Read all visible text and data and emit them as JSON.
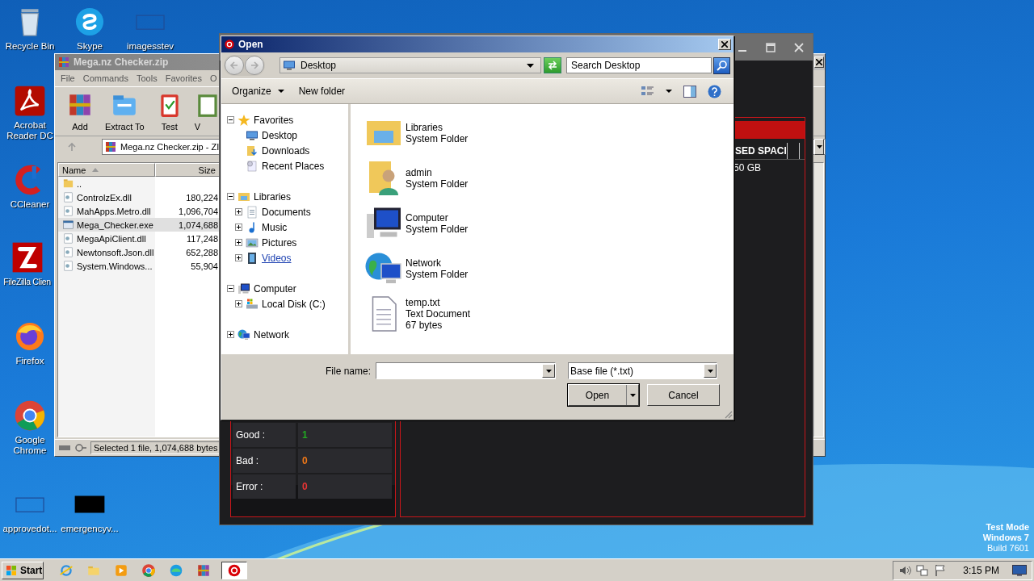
{
  "desktop_icons": [
    {
      "label": "Recycle Bin",
      "kind": "recycle"
    },
    {
      "label": "Skype",
      "kind": "skype"
    },
    {
      "label": "imagesstev",
      "kind": "blankimg"
    },
    {
      "label": "Acrobat Reader DC",
      "kind": "acrobat"
    },
    {
      "label": "CCleaner",
      "kind": "ccleaner"
    },
    {
      "label": "FileZilla Clien",
      "kind": "filezilla"
    },
    {
      "label": "Firefox",
      "kind": "firefox"
    },
    {
      "label": "Google Chrome",
      "kind": "chrome"
    },
    {
      "label": "approvedot...",
      "kind": "blankimg"
    },
    {
      "label": "emergencyv...",
      "kind": "blackimg"
    }
  ],
  "archive_window": {
    "title": "Mega.nz Checker.zip",
    "menu": [
      "File",
      "Commands",
      "Tools",
      "Favorites",
      "O"
    ],
    "toolbar": [
      {
        "label": "Add",
        "kind": "add"
      },
      {
        "label": "Extract To",
        "kind": "extract"
      },
      {
        "label": "Test",
        "kind": "test"
      },
      {
        "label": "V",
        "kind": "view"
      }
    ],
    "address": "Mega.nz Checker.zip - ZI",
    "columns": [
      "Name",
      "Size"
    ],
    "rows": [
      {
        "name": "..",
        "kind": "folderup",
        "selected": false
      },
      {
        "name": "ControlzEx.dll",
        "size": "180,224",
        "kind": "dll",
        "selected": false
      },
      {
        "name": "MahApps.Metro.dll",
        "size": "1,096,704",
        "kind": "dll",
        "selected": false
      },
      {
        "name": "Mega_Checker.exe",
        "size": "1,074,688",
        "kind": "exe",
        "selected": true
      },
      {
        "name": "MegaApiClient.dll",
        "size": "117,248",
        "kind": "dll",
        "selected": false
      },
      {
        "name": "Newtonsoft.Json.dll",
        "size": "652,288",
        "kind": "dll",
        "selected": false
      },
      {
        "name": "System.Windows...",
        "size": "55,904",
        "kind": "dll",
        "selected": false
      }
    ],
    "status": "Selected 1 file, 1,074,688 bytes"
  },
  "checker_window": {
    "column_header": "SED SPACI",
    "cell": "50 GB",
    "stats": [
      {
        "label": "Good :",
        "value": "1",
        "color": "#22a822"
      },
      {
        "label": "Bad :",
        "value": "0",
        "color": "#f07818"
      },
      {
        "label": "Error :",
        "value": "0",
        "color": "#e83434"
      }
    ]
  },
  "open_dialog": {
    "title": "Open",
    "location": "Desktop",
    "search": {
      "placeholder": "Search Desktop"
    },
    "toolbar": [
      "Organize",
      "New folder"
    ],
    "tree": [
      {
        "label": "Favorites",
        "kind": "star",
        "expanded": true,
        "hovered": false,
        "children": [
          {
            "label": "Desktop",
            "kind": "desktop",
            "hovered": false
          },
          {
            "label": "Downloads",
            "kind": "downloads",
            "hovered": false
          },
          {
            "label": "Recent Places",
            "kind": "recent",
            "hovered": false
          }
        ]
      },
      {
        "label": "Libraries",
        "kind": "library",
        "expanded": true,
        "hovered": false,
        "children": [
          {
            "label": "Documents",
            "kind": "documents",
            "expanded": false,
            "hovered": false
          },
          {
            "label": "Music",
            "kind": "music",
            "expanded": false,
            "hovered": false
          },
          {
            "label": "Pictures",
            "kind": "pictures",
            "expanded": false,
            "hovered": false
          },
          {
            "label": "Videos",
            "kind": "videos",
            "expanded": false,
            "hovered": true
          }
        ]
      },
      {
        "label": "Computer",
        "kind": "computer",
        "expanded": true,
        "hovered": false,
        "children": [
          {
            "label": "Local Disk (C:)",
            "kind": "disk",
            "expanded": false,
            "hovered": false
          }
        ]
      },
      {
        "label": "Network",
        "kind": "network",
        "expanded": false,
        "hovered": false
      }
    ],
    "items": [
      {
        "name": "Libraries",
        "type": "System Folder",
        "kind": "library"
      },
      {
        "name": "admin",
        "type": "System Folder",
        "kind": "user"
      },
      {
        "name": "Computer",
        "type": "System Folder",
        "kind": "computer"
      },
      {
        "name": "Network",
        "type": "System Folder",
        "kind": "network"
      },
      {
        "name": "temp.txt",
        "type": "Text Document",
        "size": "67 bytes",
        "kind": "textfile"
      }
    ],
    "file_name_label": "File name:",
    "file_type": "Base file (*.txt)",
    "buttons": [
      "Open",
      "Cancel"
    ]
  },
  "taskbar": {
    "start": "Start",
    "apps": [
      {
        "kind": "ie",
        "selected": false
      },
      {
        "kind": "explorer",
        "selected": false
      },
      {
        "kind": "media",
        "selected": false
      },
      {
        "kind": "chrome",
        "selected": false
      },
      {
        "kind": "edge",
        "selected": false
      },
      {
        "kind": "winrar",
        "selected": false
      },
      {
        "kind": "mega",
        "selected": true
      }
    ],
    "clock": "3:15 PM"
  },
  "notice": [
    "Test Mode",
    "Windows 7",
    "Build 7601"
  ]
}
